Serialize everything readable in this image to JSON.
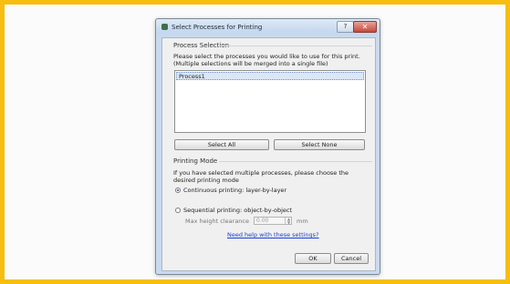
{
  "dialog": {
    "title": "Select Processes for Printing",
    "help_glyph": "?",
    "close_glyph": "✕"
  },
  "process_selection": {
    "group_title": "Process Selection",
    "description_line1": "Please select the processes you would like to use for this print.",
    "description_line2": "(Multiple selections will be merged into a single file)",
    "items": [
      "Process1"
    ],
    "select_all_label": "Select All",
    "select_none_label": "Select None"
  },
  "printing_mode": {
    "group_title": "Printing Mode",
    "description_line1": "If you have selected multiple processes, please choose the",
    "description_line2": "desired printing mode",
    "option_continuous": "Continuous printing: layer-by-layer",
    "option_sequential": "Sequential printing: object-by-object",
    "selected": "continuous",
    "max_height_label": "Max height clearance",
    "max_height_value": "0.00",
    "max_height_unit": "mm",
    "help_link": "Need help with these settings?"
  },
  "buttons": {
    "ok_label": "OK",
    "cancel_label": "Cancel"
  },
  "colors": {
    "frame_border": "#f7be0f",
    "link": "#1a3fd0",
    "close_button": "#c4473a"
  }
}
